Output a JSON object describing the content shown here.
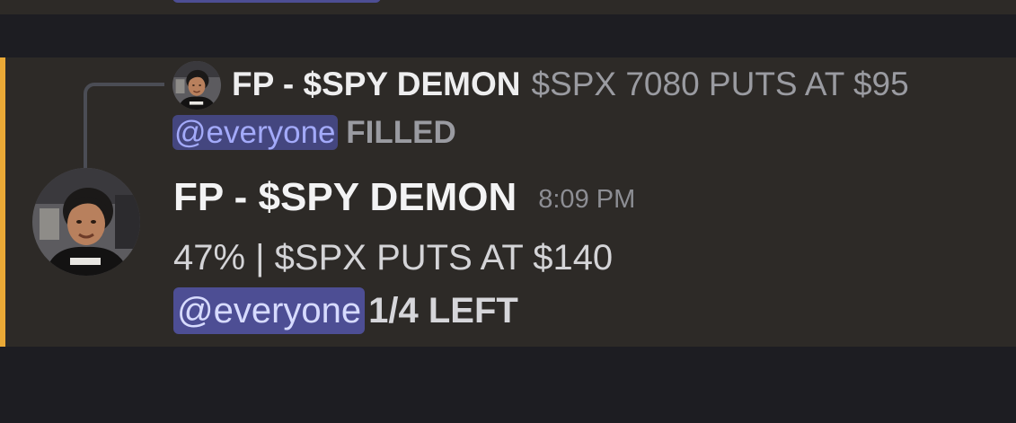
{
  "top_message": {
    "mention_fragment": ""
  },
  "reply": {
    "author": "FP - $SPY DEMON",
    "content": "$SPX 7080 PUTS AT $95",
    "mention": "@everyone",
    "text": "FILLED"
  },
  "message": {
    "author": "FP - $SPY DEMON",
    "timestamp": "8:09 PM",
    "line1": "47% | $SPX PUTS AT $140",
    "mention": "@everyone",
    "line2": "1/4 LEFT"
  },
  "colors": {
    "message_bg": "#2d2a27",
    "app_bg": "#1d1d22",
    "highlight_bar": "#eaa936",
    "mention_bg": "#4d4e94",
    "mention_text": "#d7dbff",
    "author_text": "#f3f3f4",
    "muted_text": "#9a9ba1"
  },
  "icons": {
    "reply_avatar": "user-avatar",
    "main_avatar": "user-avatar"
  }
}
